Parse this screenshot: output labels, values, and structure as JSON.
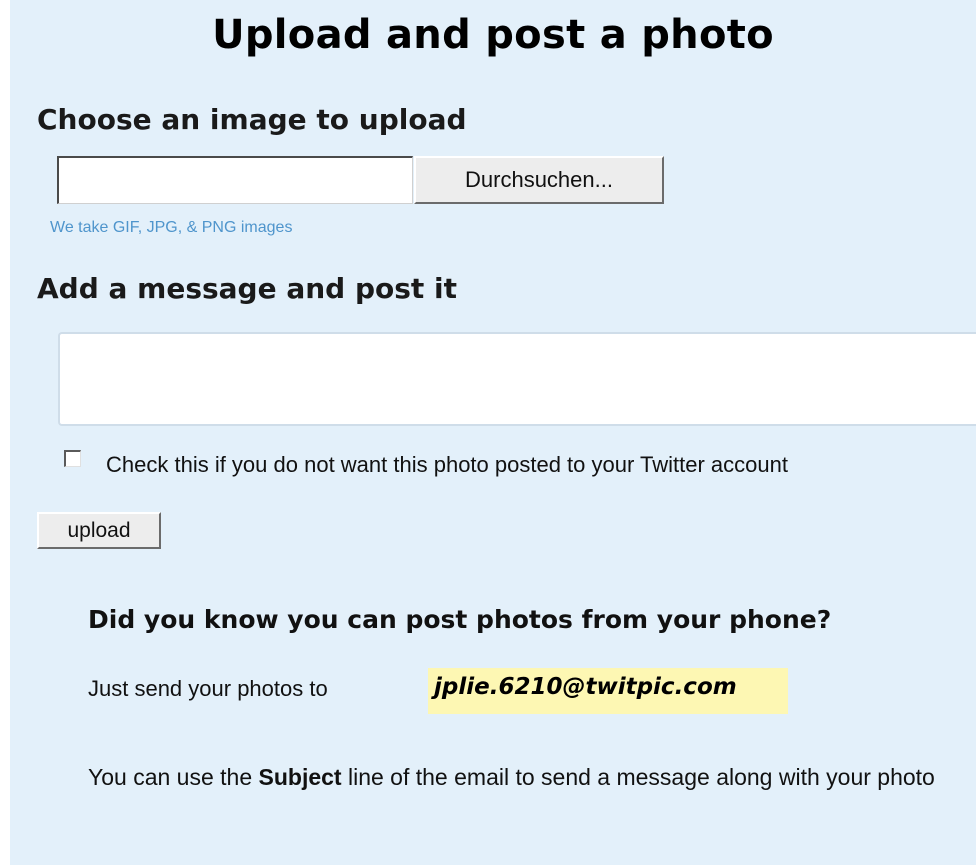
{
  "page": {
    "title": "Upload and post a photo"
  },
  "upload_section": {
    "heading": "Choose an image to upload",
    "file_input_value": "",
    "browse_button_label": "Durchsuchen...",
    "hint": "We take GIF, JPG, & PNG images"
  },
  "message_section": {
    "heading": "Add a message and post it",
    "message_value": "",
    "checkbox_checked": false,
    "checkbox_label": "Check this if you do not want this photo posted to your Twitter account",
    "upload_button_label": "upload"
  },
  "phone_section": {
    "heading": "Did you know you can post photos from your phone?",
    "send_prefix": "Just send your photos to",
    "email": "jplie.6210@twitpic.com",
    "subject_before": "You can use the ",
    "subject_keyword": "Subject",
    "subject_after": " line of the email to send a message along with your photo"
  },
  "colors": {
    "panel_background": "#e3f0fa",
    "hint_text": "#4f95cc",
    "email_highlight": "#fdf7b3"
  }
}
